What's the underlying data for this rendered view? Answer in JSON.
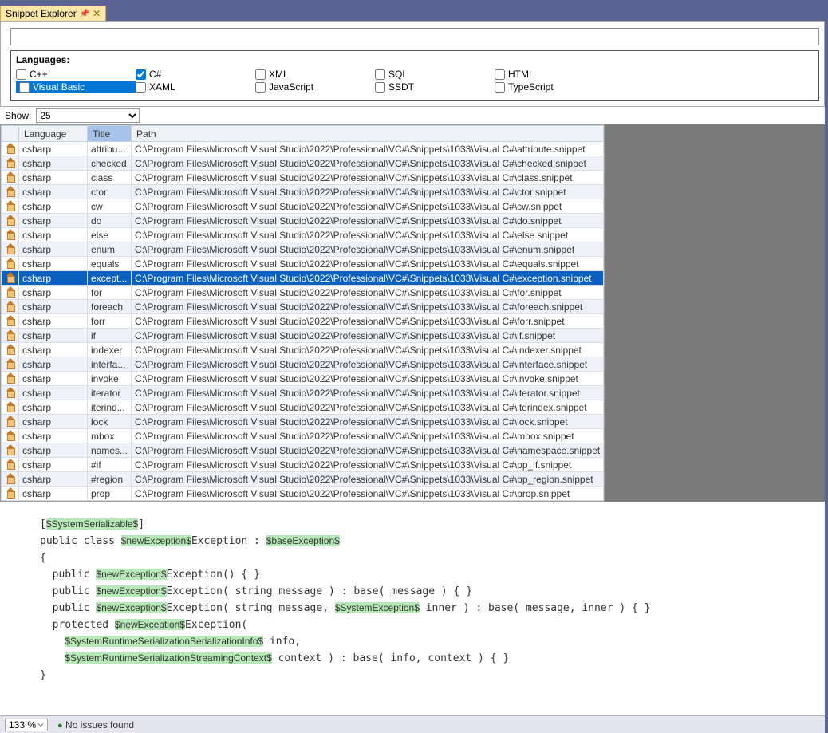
{
  "tab": {
    "title": "Snippet Explorer"
  },
  "search": {
    "placeholder": ""
  },
  "languages": {
    "label": "Languages:",
    "items": [
      {
        "label": "C++",
        "checked": false,
        "selected": false
      },
      {
        "label": "C#",
        "checked": true,
        "selected": false
      },
      {
        "label": "XML",
        "checked": false,
        "selected": false
      },
      {
        "label": "SQL",
        "checked": false,
        "selected": false
      },
      {
        "label": "HTML",
        "checked": false,
        "selected": false
      },
      {
        "label": "Visual Basic",
        "checked": false,
        "selected": true
      },
      {
        "label": "XAML",
        "checked": false,
        "selected": false
      },
      {
        "label": "JavaScript",
        "checked": false,
        "selected": false
      },
      {
        "label": "SSDT",
        "checked": false,
        "selected": false
      },
      {
        "label": "TypeScript",
        "checked": false,
        "selected": false
      }
    ]
  },
  "show": {
    "label": "Show:",
    "value": "25"
  },
  "headers": {
    "language": "Language",
    "title": "Title",
    "path": "Path"
  },
  "selected_index": 9,
  "path_prefix": "C:\\Program Files\\Microsoft Visual Studio\\2022\\Professional\\VC#\\Snippets\\1033\\Visual C#\\",
  "rows": [
    {
      "lang": "csharp",
      "title": "attribu...",
      "file": "attribute.snippet"
    },
    {
      "lang": "csharp",
      "title": "checked",
      "file": "checked.snippet"
    },
    {
      "lang": "csharp",
      "title": "class",
      "file": "class.snippet"
    },
    {
      "lang": "csharp",
      "title": "ctor",
      "file": "ctor.snippet"
    },
    {
      "lang": "csharp",
      "title": "cw",
      "file": "cw.snippet"
    },
    {
      "lang": "csharp",
      "title": "do",
      "file": "do.snippet"
    },
    {
      "lang": "csharp",
      "title": "else",
      "file": "else.snippet"
    },
    {
      "lang": "csharp",
      "title": "enum",
      "file": "enum.snippet"
    },
    {
      "lang": "csharp",
      "title": "equals",
      "file": "equals.snippet"
    },
    {
      "lang": "csharp",
      "title": "except...",
      "file": "exception.snippet"
    },
    {
      "lang": "csharp",
      "title": "for",
      "file": "for.snippet"
    },
    {
      "lang": "csharp",
      "title": "foreach",
      "file": "foreach.snippet"
    },
    {
      "lang": "csharp",
      "title": "forr",
      "file": "forr.snippet"
    },
    {
      "lang": "csharp",
      "title": "if",
      "file": "if.snippet"
    },
    {
      "lang": "csharp",
      "title": "indexer",
      "file": "indexer.snippet"
    },
    {
      "lang": "csharp",
      "title": "interfa...",
      "file": "interface.snippet"
    },
    {
      "lang": "csharp",
      "title": "invoke",
      "file": "invoke.snippet"
    },
    {
      "lang": "csharp",
      "title": "iterator",
      "file": "iterator.snippet"
    },
    {
      "lang": "csharp",
      "title": "iterind...",
      "file": "iterindex.snippet"
    },
    {
      "lang": "csharp",
      "title": "lock",
      "file": "lock.snippet"
    },
    {
      "lang": "csharp",
      "title": "mbox",
      "file": "mbox.snippet"
    },
    {
      "lang": "csharp",
      "title": "names...",
      "file": "namespace.snippet"
    },
    {
      "lang": "csharp",
      "title": "#if",
      "file": "pp_if.snippet"
    },
    {
      "lang": "csharp",
      "title": "#region",
      "file": "pp_region.snippet"
    },
    {
      "lang": "csharp",
      "title": "prop",
      "file": "prop.snippet"
    }
  ],
  "code": {
    "tokens": [
      "[",
      [
        "$SystemSerializable$"
      ],
      "]\n",
      "public class ",
      [
        "$newException$"
      ],
      "Exception : ",
      [
        "$baseException$"
      ],
      "\n",
      "{\n",
      "  public ",
      [
        "$newException$"
      ],
      "Exception() { }\n",
      "  public ",
      [
        "$newException$"
      ],
      "Exception( string message ) : base( message ) { }\n",
      "  public ",
      [
        "$newException$"
      ],
      "Exception( string message, ",
      [
        "$SystemException$"
      ],
      " inner ) : base( message, inner ) { }\n",
      "  protected ",
      [
        "$newException$"
      ],
      "Exception(\n",
      "    ",
      [
        "$SystemRuntimeSerializationSerializationInfo$"
      ],
      " info,\n",
      "    ",
      [
        "$SystemRuntimeSerializationStreamingContext$"
      ],
      " context ) : base( info, context ) { }\n",
      "}"
    ]
  },
  "status": {
    "zoom": "133 %",
    "issues": "No issues found"
  }
}
